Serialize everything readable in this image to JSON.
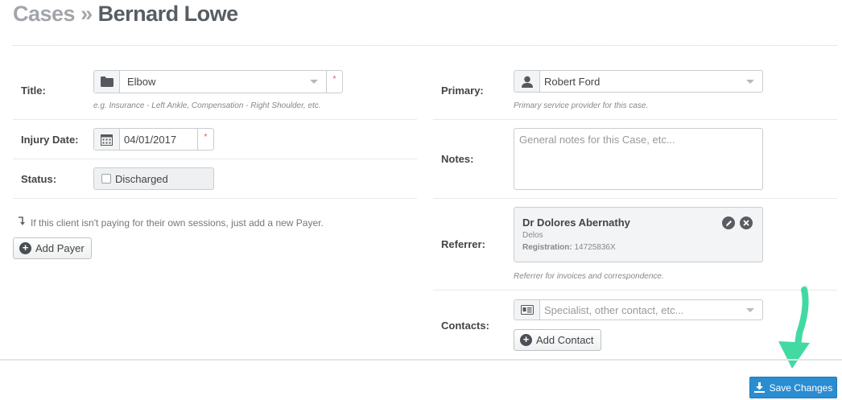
{
  "breadcrumb": {
    "section": "Cases",
    "separator": "»",
    "name": "Bernard Lowe"
  },
  "left": {
    "title": {
      "label": "Title:",
      "value": "Elbow",
      "help": "e.g. Insurance - Left Ankle, Compensation - Right Shoulder, etc.",
      "required_mark": "*",
      "icon": "folder-icon"
    },
    "injury_date": {
      "label": "Injury Date:",
      "value": "04/01/2017",
      "required_mark": "*",
      "icon": "calendar-icon"
    },
    "status": {
      "label": "Status:",
      "checkbox_label": "Discharged",
      "checked": false
    },
    "payer_hint": "If this client isn't paying for their own sessions, just add a new Payer.",
    "add_payer": "Add Payer"
  },
  "right": {
    "primary": {
      "label": "Primary:",
      "value": "Robert Ford",
      "help": "Primary service provider for this case.",
      "icon": "user-icon"
    },
    "notes": {
      "label": "Notes:",
      "placeholder": "General notes for this Case, etc..."
    },
    "referrer": {
      "label": "Referrer:",
      "name": "Dr Dolores Abernathy",
      "org": "Delos",
      "reg_label": "Registration:",
      "reg_value": "14725836X",
      "help": "Referrer for invoices and correspondence."
    },
    "contacts": {
      "label": "Contacts:",
      "placeholder": "Specialist, other contact, etc...",
      "add_button": "Add Contact",
      "icon": "contact-card-icon"
    }
  },
  "footer": {
    "save_button": "Save Changes",
    "save_icon": "download-icon"
  },
  "colors": {
    "accent": "#2a8dd2",
    "arrow": "#43d9a3",
    "required": "#d9534f"
  }
}
